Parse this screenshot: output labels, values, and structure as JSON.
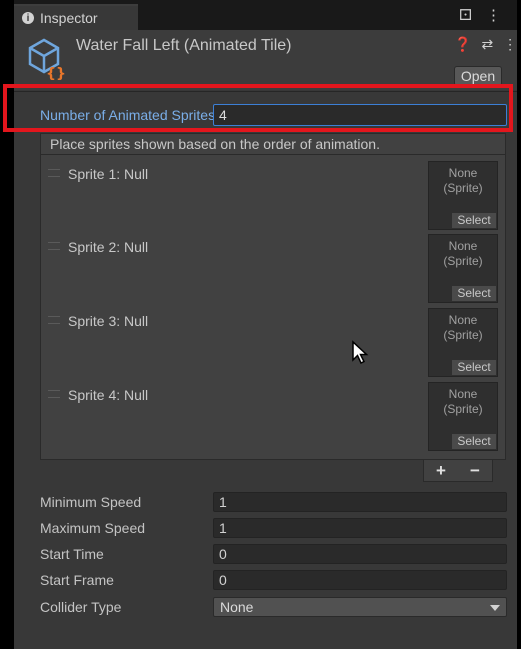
{
  "tab": {
    "label": "Inspector",
    "lock_icon": "lock-icon",
    "menu_icon": "kebab-menu-icon"
  },
  "header": {
    "title": "Water Fall Left (Animated Tile)",
    "icons": [
      "help-icon",
      "preset-settings-icon",
      "kebab-menu-icon"
    ],
    "open_label": "Open"
  },
  "animated_sprites": {
    "label": "Number of Animated Sprites",
    "value": "4",
    "list_header": "Place sprites shown based on the order of animation.",
    "items": [
      {
        "label": "Sprite 1: Null",
        "field_value": "None\n(Sprite)",
        "select_label": "Select"
      },
      {
        "label": "Sprite 2: Null",
        "field_value": "None\n(Sprite)",
        "select_label": "Select"
      },
      {
        "label": "Sprite 3: Null",
        "field_value": "None\n(Sprite)",
        "select_label": "Select"
      },
      {
        "label": "Sprite 4: Null",
        "field_value": "None\n(Sprite)",
        "select_label": "Select"
      }
    ],
    "add_label": "+",
    "remove_label": "−"
  },
  "properties": [
    {
      "label": "Minimum Speed",
      "value": "1"
    },
    {
      "label": "Maximum Speed",
      "value": "1"
    },
    {
      "label": "Start Time",
      "value": "0"
    },
    {
      "label": "Start Frame",
      "value": "0"
    }
  ],
  "collider": {
    "label": "Collider Type",
    "value": "None"
  },
  "colors": {
    "highlight": "#e3161d",
    "accent_label": "#7aaee8",
    "focus_border": "#3c7fd6"
  }
}
